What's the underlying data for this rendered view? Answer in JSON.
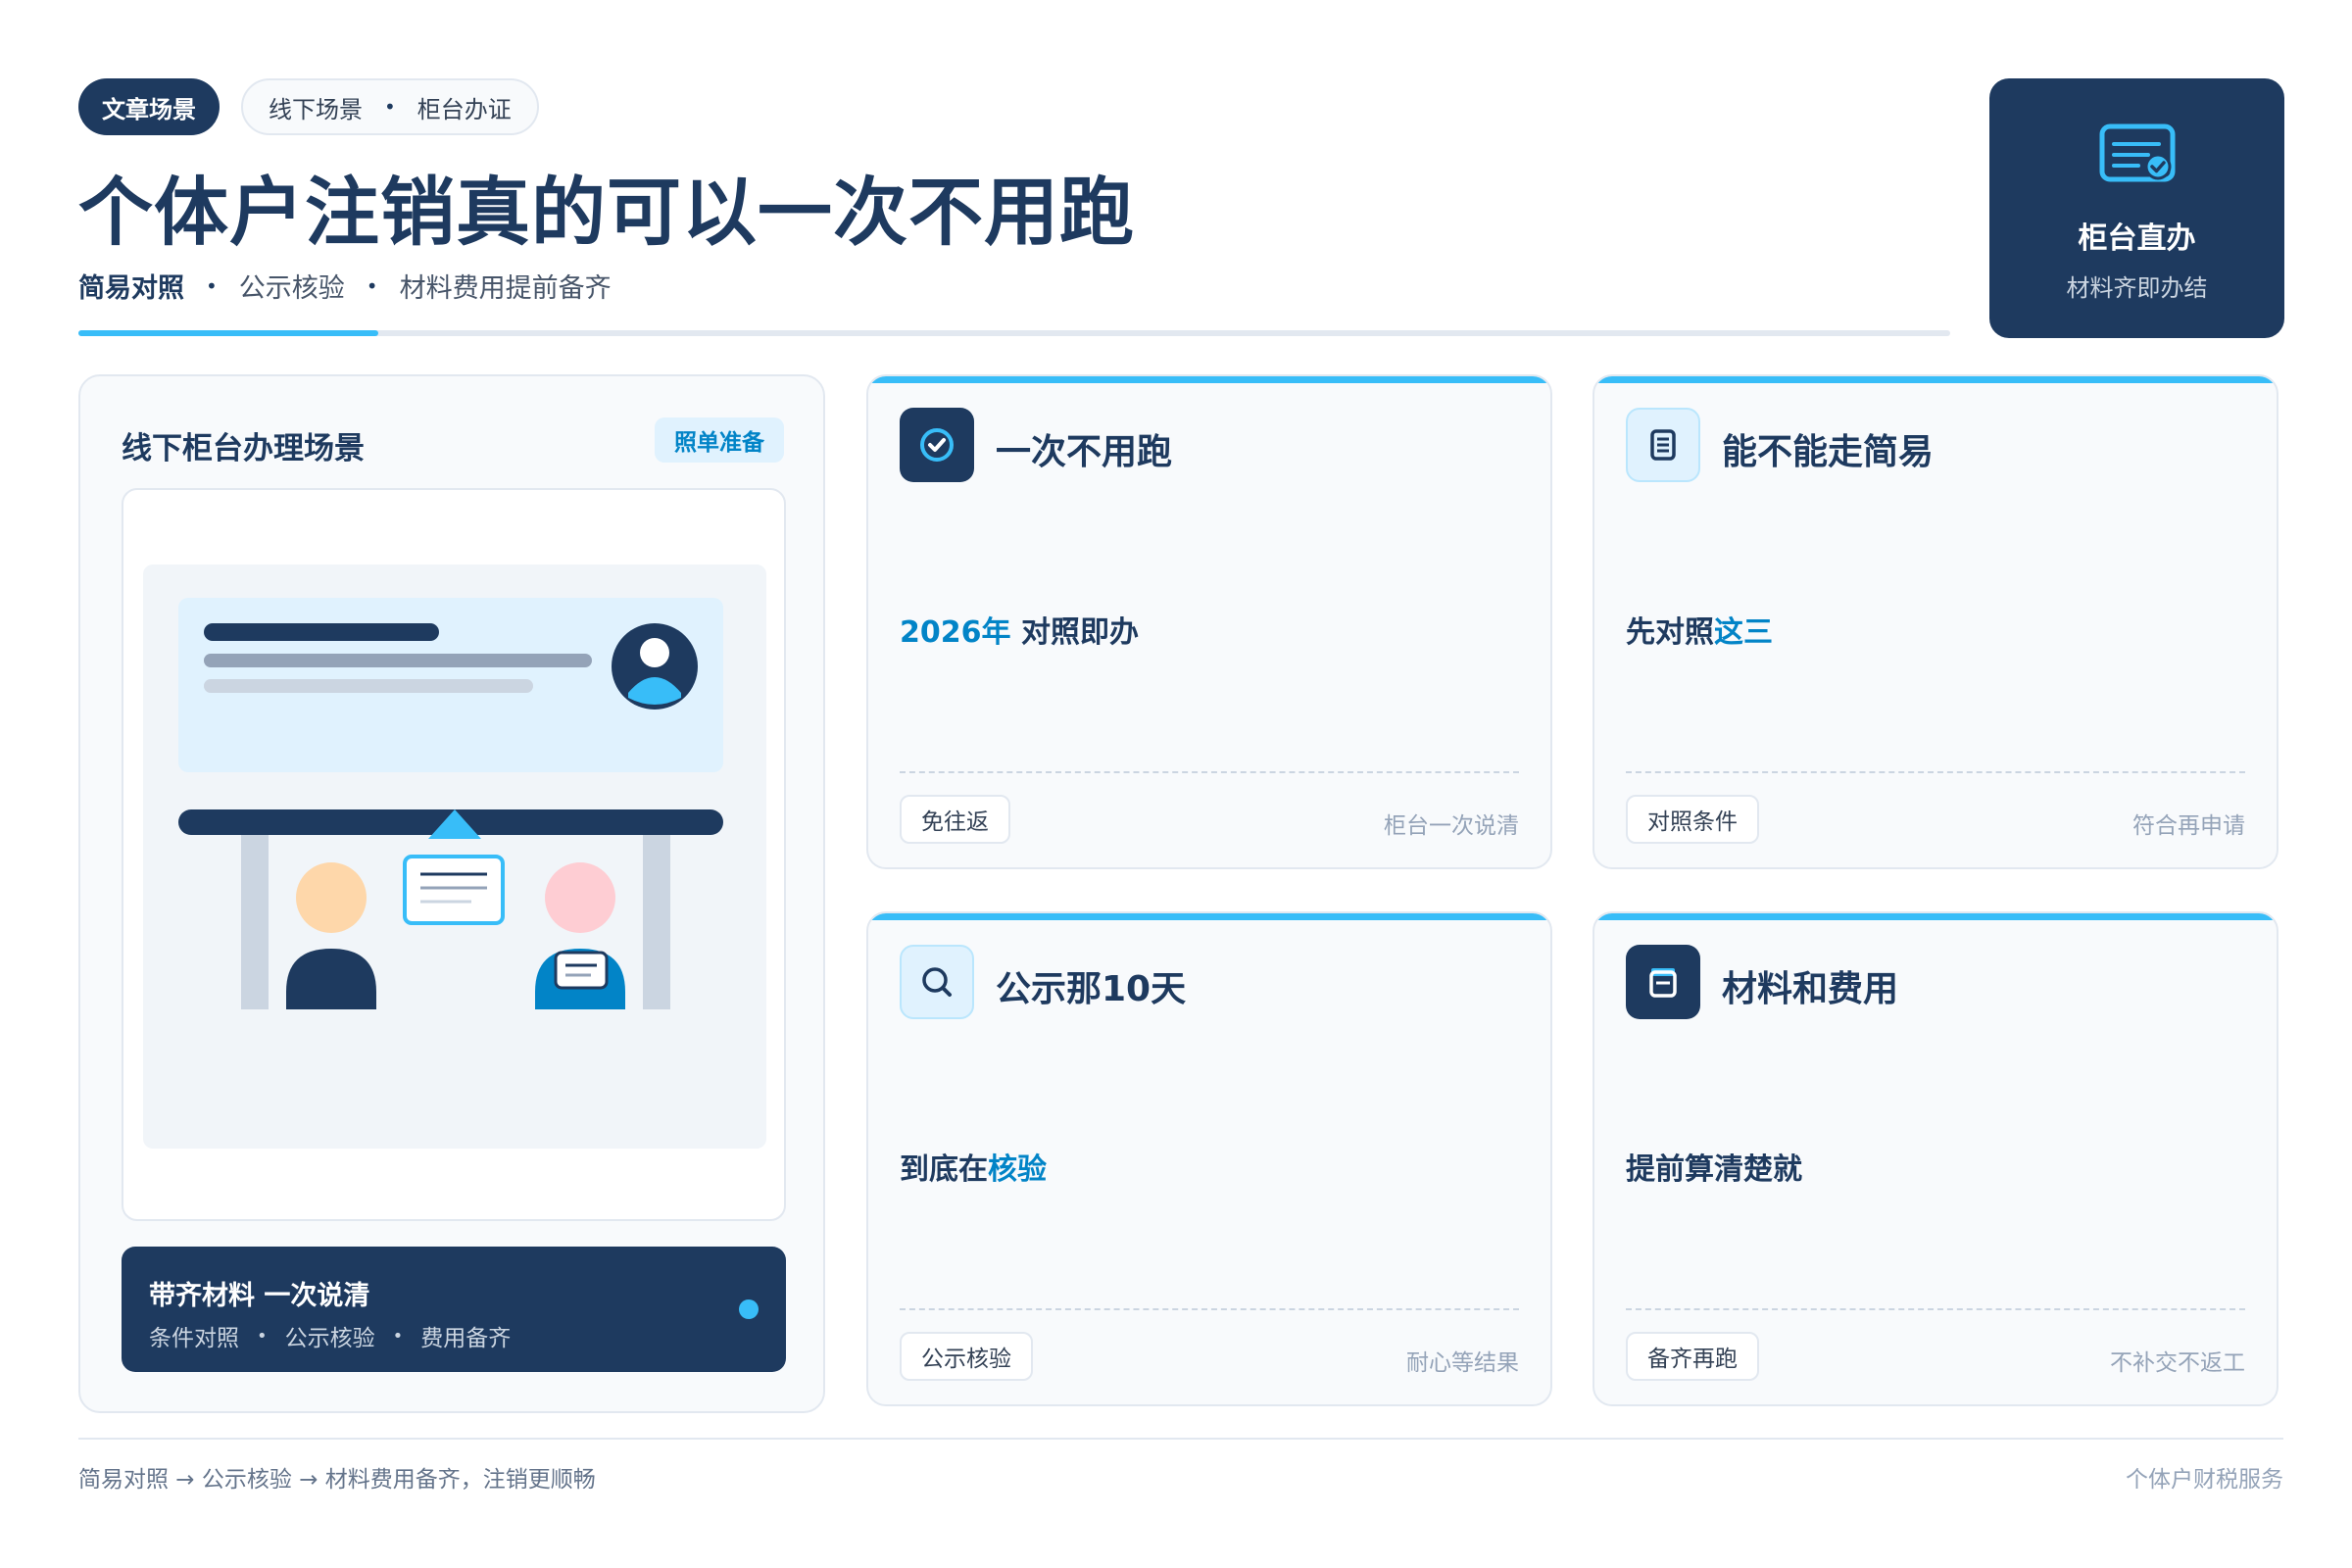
{
  "header": {
    "tag_primary": "文章场景",
    "tag_secondary": [
      "线下场景",
      "柜台办证"
    ],
    "tag_separator": "•",
    "title": "个体户注销真的可以一次不用跑",
    "subtitle_items": [
      "简易对照",
      "公示核验",
      "材料费用提前备齐"
    ],
    "progress": 0.16
  },
  "badge": {
    "icon": "certificate-check-icon",
    "title": "柜台直办",
    "subtitle": "材料齐即办结"
  },
  "scene": {
    "title": "线下柜台办理场景",
    "chip": "照单准备",
    "bar_title": "带齐材料 一次说清",
    "bar_items": [
      "条件对照",
      "公示核验",
      "费用备齐"
    ]
  },
  "cards": [
    {
      "icon": "check-circle-icon",
      "title": "一次不用跑",
      "body_highlight": "2026年",
      "body_text": " 对照即办",
      "chip": "免往返",
      "note": "柜台一次说清"
    },
    {
      "icon": "document-icon",
      "title": "能不能走简易",
      "body_text": "先对照",
      "body_highlight": "这三",
      "chip": "对照条件",
      "note": "符合再申请"
    },
    {
      "icon": "search-icon",
      "title": "公示那10天",
      "body_text": "到底在",
      "body_highlight": "核验",
      "chip": "公示核验",
      "note": "耐心等结果"
    },
    {
      "icon": "wallet-icon",
      "title": "材料和费用",
      "body_text": "提前算清楚就",
      "body_highlight": "",
      "chip": "备齐再跑",
      "note": "不补交不返工"
    }
  ],
  "footer": {
    "left": "简易对照 → 公示核验 → 材料费用备齐，注销更顺畅",
    "right": "个体户财税服务"
  },
  "colors": {
    "navy": "#1e3a5f",
    "accent": "#38bdf8",
    "highlight": "#0284c7"
  }
}
